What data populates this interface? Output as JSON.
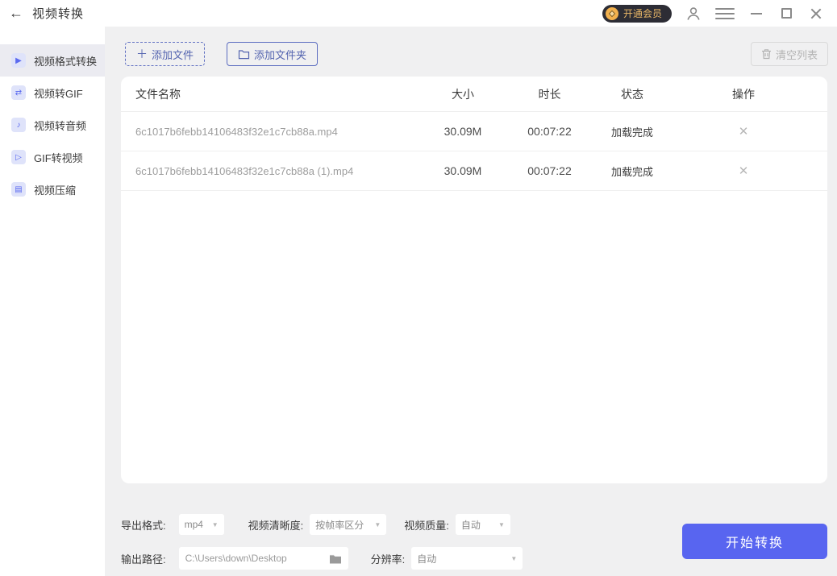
{
  "window": {
    "title": "视频转换",
    "vip_badge": "开通会员"
  },
  "icons": {
    "back": "←",
    "plus": "＋",
    "caret": "▼",
    "row_delete": "✕"
  },
  "sidebar": {
    "items": [
      {
        "label": "视频格式转换",
        "icon": "video-format-convert",
        "glyph": "▶",
        "active": true
      },
      {
        "label": "视频转GIF",
        "icon": "video-to-gif",
        "glyph": "⇄",
        "active": false
      },
      {
        "label": "视频转音频",
        "icon": "video-to-audio",
        "glyph": "♪",
        "active": false
      },
      {
        "label": "GIF转视频",
        "icon": "gif-to-video",
        "glyph": "▷",
        "active": false
      },
      {
        "label": "视频压缩",
        "icon": "video-compress",
        "glyph": "▤",
        "active": false
      }
    ]
  },
  "toolbar": {
    "add_file": "添加文件",
    "add_folder": "添加文件夹",
    "clear_list": "清空列表"
  },
  "table": {
    "columns": {
      "name": "文件名称",
      "size": "大小",
      "duration": "时长",
      "status": "状态",
      "action": "操作"
    },
    "rows": [
      {
        "name": "6c1017b6febb14106483f32e1c7cb88a.mp4",
        "size": "30.09M",
        "duration": "00:07:22",
        "status": "加载完成"
      },
      {
        "name": "6c1017b6febb14106483f32e1c7cb88a (1).mp4",
        "size": "30.09M",
        "duration": "00:07:22",
        "status": "加载完成"
      }
    ]
  },
  "settings": {
    "export_format_label": "导出格式:",
    "export_format_value": "mp4",
    "clarity_label": "视频清晰度:",
    "clarity_value": "按帧率区分",
    "quality_label": "视频质量:",
    "quality_value": "自动",
    "output_path_label": "输出路径:",
    "output_path_value": "C:\\Users\\down\\Desktop",
    "resolution_label": "分辨率:",
    "resolution_value": "自动"
  },
  "actions": {
    "start": "开始转换"
  },
  "colors": {
    "accent": "#5865f0",
    "sidebar_icon": "#5b6af0",
    "vip_gold": "#e9b767",
    "vip_bg": "#2d2d35"
  }
}
